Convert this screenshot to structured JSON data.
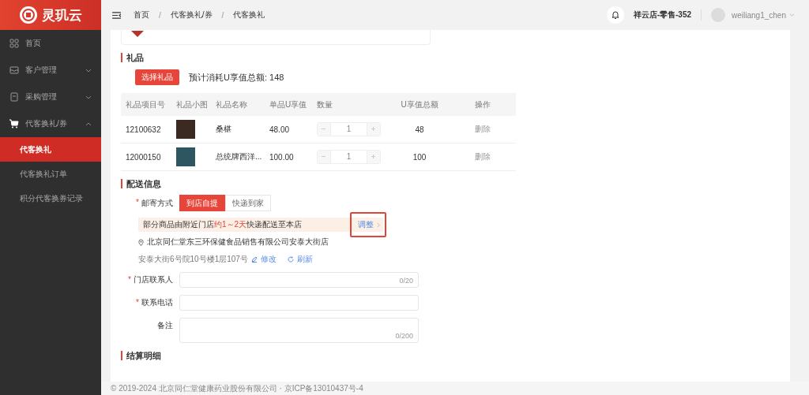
{
  "app": {
    "logo_text": "灵玑云"
  },
  "breadcrumb": [
    {
      "label": "首页"
    },
    {
      "label": "代客换礼/券"
    },
    {
      "label": "代客换礼"
    }
  ],
  "breadcrumb_separator": "/",
  "header": {
    "store": "祥云店-零售-352",
    "user": "weiliang1_chen"
  },
  "sidebar": {
    "items": [
      {
        "label": "首页",
        "selected": false
      },
      {
        "label": "客户管理",
        "selected": false,
        "expanded": false
      },
      {
        "label": "采购管理",
        "selected": false,
        "expanded": false
      },
      {
        "label": "代客换礼/券",
        "selected": false,
        "expanded": true,
        "children": [
          {
            "label": "代客换礼",
            "selected": true
          },
          {
            "label": "代客换礼订单",
            "selected": false
          },
          {
            "label": "积分代客换券记录",
            "selected": false
          }
        ]
      }
    ]
  },
  "gifts": {
    "title": "礼品",
    "button": "选择礼品",
    "total": "预计消耗U享值总额: 148",
    "columns": [
      "礼品项目号",
      "礼品小图",
      "礼品名称",
      "单品U享值",
      "数量",
      "U享值总额",
      "操作"
    ],
    "rows": [
      {
        "id": "12100632",
        "name": "桑椹",
        "unit": "48.00",
        "qty": "1",
        "total": "48",
        "action": "删除"
      },
      {
        "id": "12000150",
        "name": "总统牌西洋...",
        "unit": "100.00",
        "qty": "1",
        "total": "100",
        "action": "删除"
      }
    ]
  },
  "delivery": {
    "title": "配送信息",
    "required_mark": "*",
    "method_label": "邮寄方式",
    "options": [
      {
        "label": "到店自提",
        "selected": true
      },
      {
        "label": "快递到家",
        "selected": false
      }
    ],
    "notice": "部分商品由附近门店**约1～2天**快递配送至本店",
    "adjust": "调整",
    "store_name": "北京同仁堂东三环保健食品销售有限公司安泰大街店",
    "address": "安泰大街6号院10号楼1层107号",
    "edit": "修改",
    "refresh": "刷新",
    "fields": [
      {
        "label": "门店联系人",
        "required": true,
        "kind": "input",
        "counter": "0/20"
      },
      {
        "label": "联系电话",
        "required": true,
        "kind": "input"
      },
      {
        "label": "备注",
        "required": false,
        "kind": "textarea",
        "counter": "0/200"
      }
    ]
  },
  "settlement": {
    "title": "结算明细"
  },
  "footer": "© 2019-2024 北京同仁堂健康药业股份有限公司 · 京ICP备13010437号-4"
}
